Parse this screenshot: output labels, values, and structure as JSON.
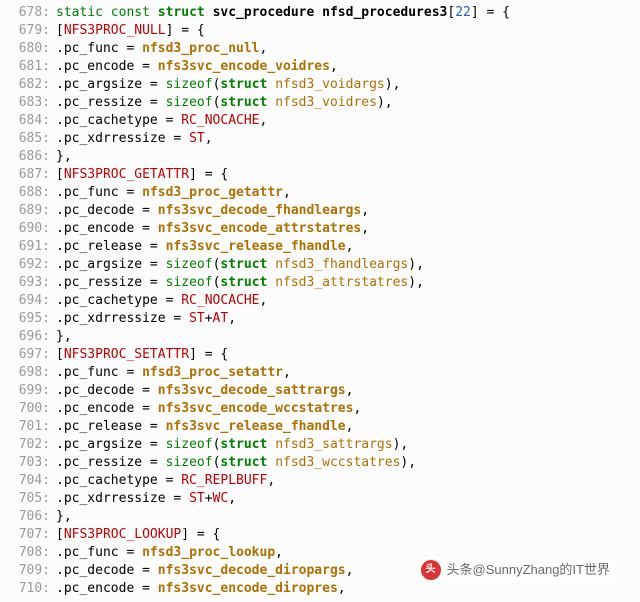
{
  "watermark": "头条@SunnyZhang的IT世界",
  "avatar_text": "头",
  "decl": {
    "kw_static": "static",
    "kw_const": "const",
    "kw_struct": "struct",
    "type": "svc_procedure",
    "var": "nfsd_procedures3",
    "size": "22"
  },
  "fields": [
    "pc_func",
    "pc_decode",
    "pc_encode",
    "pc_release",
    "pc_argsize",
    "pc_ressize",
    "pc_cachetype",
    "pc_xdrressize"
  ],
  "kw_sizeof": "sizeof",
  "kw_struct2": "struct",
  "lines": [
    {
      "n": 678,
      "kind": "decl"
    },
    {
      "n": 679,
      "kind": "entry_open",
      "key": "NFS3PROC_NULL"
    },
    {
      "n": 680,
      "kind": "assign",
      "f": 0,
      "rhs": [
        {
          "t": "func",
          "s": "nfsd3_proc_null"
        }
      ]
    },
    {
      "n": 681,
      "kind": "assign",
      "f": 2,
      "rhs": [
        {
          "t": "func",
          "s": "nfs3svc_encode_voidres"
        }
      ]
    },
    {
      "n": 682,
      "kind": "assign",
      "f": 4,
      "rhs": [
        {
          "t": "sizeof",
          "st": "nfsd3_voidargs"
        }
      ]
    },
    {
      "n": 683,
      "kind": "assign",
      "f": 5,
      "rhs": [
        {
          "t": "sizeof",
          "st": "nfsd3_voidres"
        }
      ]
    },
    {
      "n": 684,
      "kind": "assign",
      "f": 6,
      "rhs": [
        {
          "t": "macro",
          "s": "RC_NOCACHE"
        }
      ]
    },
    {
      "n": 685,
      "kind": "assign",
      "f": 7,
      "rhs": [
        {
          "t": "macro",
          "s": "ST"
        }
      ]
    },
    {
      "n": 686,
      "kind": "entry_close"
    },
    {
      "n": 687,
      "kind": "entry_open",
      "key": "NFS3PROC_GETATTR"
    },
    {
      "n": 688,
      "kind": "assign",
      "f": 0,
      "rhs": [
        {
          "t": "func",
          "s": "nfsd3_proc_getattr"
        }
      ]
    },
    {
      "n": 689,
      "kind": "assign",
      "f": 1,
      "rhs": [
        {
          "t": "func",
          "s": "nfs3svc_decode_fhandleargs"
        }
      ]
    },
    {
      "n": 690,
      "kind": "assign",
      "f": 2,
      "rhs": [
        {
          "t": "func",
          "s": "nfs3svc_encode_attrstatres"
        }
      ]
    },
    {
      "n": 691,
      "kind": "assign",
      "f": 3,
      "rhs": [
        {
          "t": "func",
          "s": "nfs3svc_release_fhandle"
        }
      ]
    },
    {
      "n": 692,
      "kind": "assign",
      "f": 4,
      "rhs": [
        {
          "t": "sizeof",
          "st": "nfsd3_fhandleargs"
        }
      ]
    },
    {
      "n": 693,
      "kind": "assign",
      "f": 5,
      "rhs": [
        {
          "t": "sizeof",
          "st": "nfsd3_attrstatres"
        }
      ]
    },
    {
      "n": 694,
      "kind": "assign",
      "f": 6,
      "rhs": [
        {
          "t": "macro",
          "s": "RC_NOCACHE"
        }
      ]
    },
    {
      "n": 695,
      "kind": "assign",
      "f": 7,
      "rhs": [
        {
          "t": "macro",
          "s": "ST"
        },
        {
          "t": "plus"
        },
        {
          "t": "macro",
          "s": "AT"
        }
      ]
    },
    {
      "n": 696,
      "kind": "entry_close"
    },
    {
      "n": 697,
      "kind": "entry_open",
      "key": "NFS3PROC_SETATTR"
    },
    {
      "n": 698,
      "kind": "assign",
      "f": 0,
      "rhs": [
        {
          "t": "func",
          "s": "nfsd3_proc_setattr"
        }
      ]
    },
    {
      "n": 699,
      "kind": "assign",
      "f": 1,
      "rhs": [
        {
          "t": "func",
          "s": "nfs3svc_decode_sattrargs"
        }
      ]
    },
    {
      "n": 700,
      "kind": "assign",
      "f": 2,
      "rhs": [
        {
          "t": "func",
          "s": "nfs3svc_encode_wccstatres"
        }
      ]
    },
    {
      "n": 701,
      "kind": "assign",
      "f": 3,
      "rhs": [
        {
          "t": "func",
          "s": "nfs3svc_release_fhandle"
        }
      ]
    },
    {
      "n": 702,
      "kind": "assign",
      "f": 4,
      "rhs": [
        {
          "t": "sizeof",
          "st": "nfsd3_sattrargs"
        }
      ]
    },
    {
      "n": 703,
      "kind": "assign",
      "f": 5,
      "rhs": [
        {
          "t": "sizeof",
          "st": "nfsd3_wccstatres"
        }
      ]
    },
    {
      "n": 704,
      "kind": "assign",
      "f": 6,
      "rhs": [
        {
          "t": "macro",
          "s": "RC_REPLBUFF"
        }
      ]
    },
    {
      "n": 705,
      "kind": "assign",
      "f": 7,
      "rhs": [
        {
          "t": "macro",
          "s": "ST"
        },
        {
          "t": "plus"
        },
        {
          "t": "macro",
          "s": "WC"
        }
      ]
    },
    {
      "n": 706,
      "kind": "entry_close"
    },
    {
      "n": 707,
      "kind": "entry_open",
      "key": "NFS3PROC_LOOKUP"
    },
    {
      "n": 708,
      "kind": "assign",
      "f": 0,
      "rhs": [
        {
          "t": "func",
          "s": "nfsd3_proc_lookup"
        }
      ]
    },
    {
      "n": 709,
      "kind": "assign",
      "f": 1,
      "rhs": [
        {
          "t": "func",
          "s": "nfs3svc_decode_diropargs"
        }
      ]
    },
    {
      "n": 710,
      "kind": "assign",
      "f": 2,
      "rhs": [
        {
          "t": "func",
          "s": "nfs3svc_encode_diropres"
        }
      ]
    }
  ]
}
